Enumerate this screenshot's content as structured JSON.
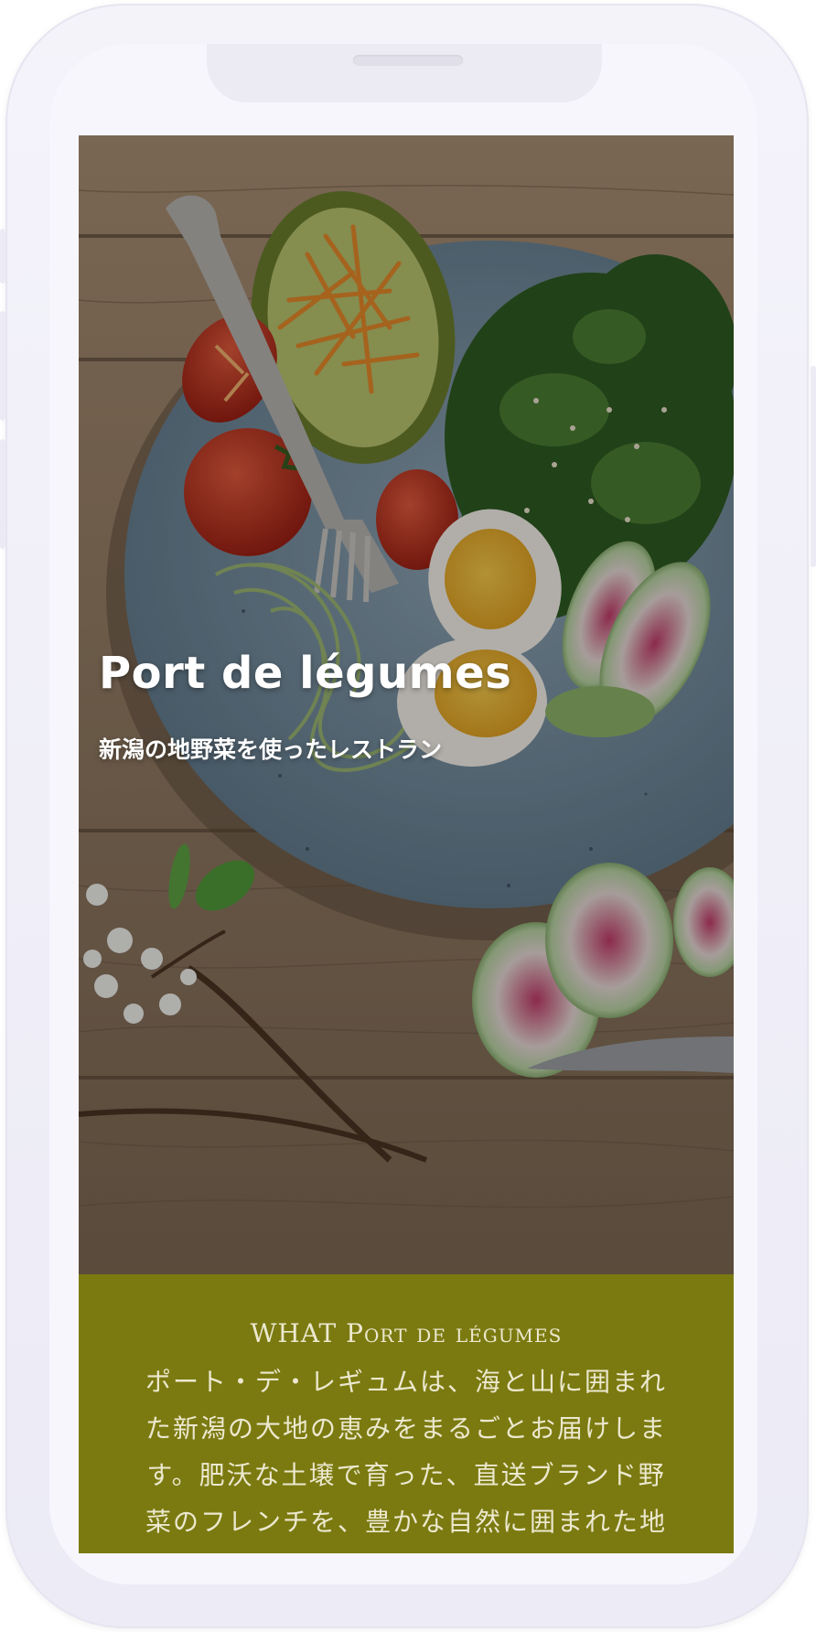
{
  "hero": {
    "title": "Port de légumes",
    "subtitle": "新潟の地野菜を使ったレストラン"
  },
  "about": {
    "heading": "WHAT Port de légumes",
    "body": "ポート・デ・レギュムは、海と山に囲まれた新潟の大地の恵みをまるごとお届けします。肥沃な土壌で育った、直送ブランド野菜のフレンチを、豊かな自然に囲まれた地元で"
  },
  "colors": {
    "accent_olive": "#7b7a10",
    "text_light": "#ece8cf",
    "frame": "#f4f3fa"
  }
}
